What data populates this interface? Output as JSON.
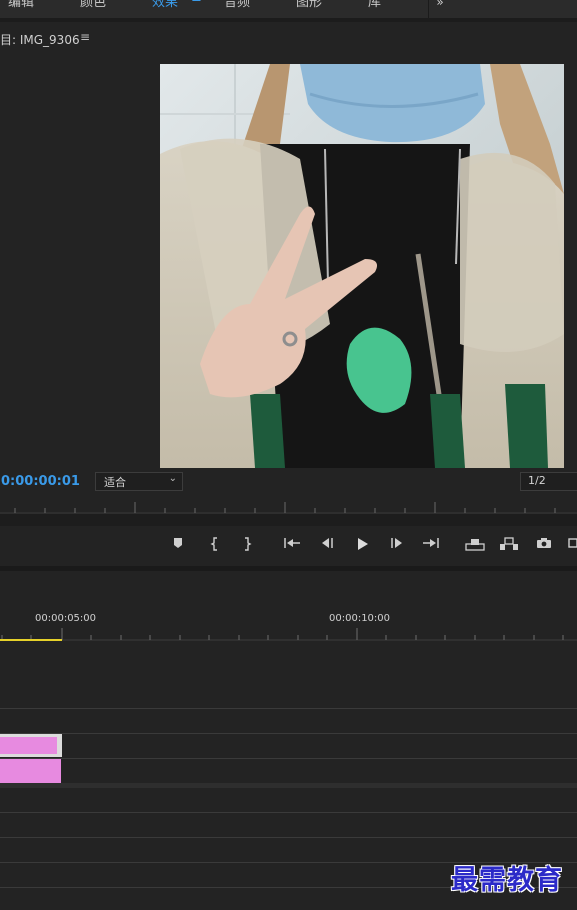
{
  "tabs": [
    {
      "label": "编辑",
      "active": false
    },
    {
      "label": "颜色",
      "active": false
    },
    {
      "label": "效果",
      "active": true
    },
    {
      "label": "音频",
      "active": false
    },
    {
      "label": "图形",
      "active": false
    },
    {
      "label": "库",
      "active": false
    }
  ],
  "tab_more_label": "»",
  "tab_menu_icon": "hamburger-icon",
  "monitor": {
    "title": "目: IMG_9306",
    "menu_icon": "hamburger-icon",
    "timecode": "0:00:00:01",
    "zoom_value": "适合",
    "resolution": "1/2"
  },
  "transport": {
    "buttons": [
      "marker",
      "mark-in",
      "mark-out",
      "go-to-in",
      "step-back",
      "play",
      "step-forward",
      "go-to-out",
      "lift",
      "extract",
      "export-frame",
      "button-editor"
    ]
  },
  "timeline": {
    "time_labels": [
      "00:00:05:00",
      "00:00:10:00"
    ]
  },
  "watermark": "最需教育",
  "colors": {
    "accent": "#3a9ae8",
    "clip": "#e78ae0",
    "work_area": "#e6d12a",
    "watermark": "#2b2ac8"
  }
}
